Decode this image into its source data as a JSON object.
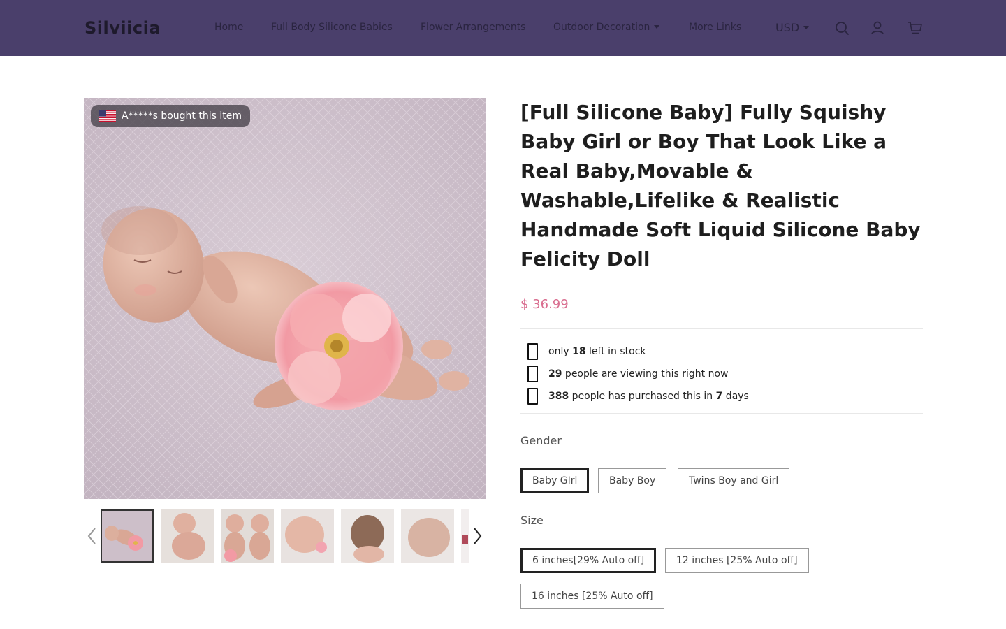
{
  "header": {
    "logo": "Silviicia",
    "nav": [
      {
        "label": "Home"
      },
      {
        "label": "Full Body Silicone Babies"
      },
      {
        "label": "Flower Arrangements"
      },
      {
        "label": "Outdoor Decoration"
      },
      {
        "label": "More Links"
      }
    ],
    "currency": "USD",
    "icons": [
      "search-icon",
      "account-icon",
      "cart-icon"
    ]
  },
  "gallery": {
    "badge_text": "A*****s bought this item",
    "badge_flag": "us-flag-icon",
    "thumbnail_count": 7,
    "active_thumbnail": 1
  },
  "product": {
    "title": "[Full Silicone Baby] Fully Squishy Baby Girl or Boy That Look Like a Real Baby,Movable & Washable,Lifelike & Realistic Handmade Soft Liquid Silicone Baby Felicity Doll",
    "price": "$ 36.99",
    "price_color": "#d96d8f",
    "stock": {
      "pre": "only ",
      "count": "18",
      "post": " left in stock"
    },
    "viewing": {
      "count": "29",
      "post": " people are viewing this right now"
    },
    "purchased": {
      "count": "388",
      "mid": " people has purchased this in ",
      "days": "7",
      "post": " days"
    }
  },
  "options": {
    "gender": {
      "label": "Gender",
      "values": [
        "Baby GIrl",
        "Baby Boy",
        "Twins Boy and Girl"
      ],
      "selected": "Baby GIrl"
    },
    "size": {
      "label": "Size",
      "values": [
        "6 inches[29% Auto off]",
        "12 inches [25% Auto off]",
        "16 inches [25% Auto off]"
      ],
      "selected": "6 inches[29% Auto off]"
    }
  },
  "colors": {
    "header_bg": "#4a3f6b",
    "accent_price": "#d96d8f"
  }
}
